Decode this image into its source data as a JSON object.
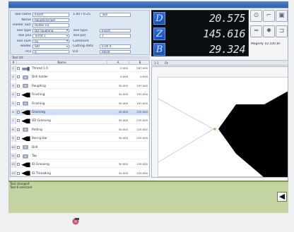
{
  "app": {
    "title": ""
  },
  "form": {
    "rows": [
      {
        "label": "Tool name",
        "v1": "Insert",
        "v1_type": "input",
        "v2": "1.00 / 0.25",
        "v3": "Tool"
      },
      {
        "label": "Name",
        "v1": "Roughing tool",
        "v1_type": "input",
        "v2": "",
        "v3": ""
      },
      {
        "label": "Holder name",
        "v1": "Holder 03",
        "v1_type": "input",
        "v2": "",
        "v3": ""
      },
      {
        "label": "Tool type",
        "v1": "OD roughing",
        "v1_type": "select",
        "v2": "Tool type",
        "v3": "Insert"
      },
      {
        "label": "Tool pos",
        "v1": "Turret 1",
        "v1_type": "select",
        "v2": "Tool pos",
        "v3": "1"
      },
      {
        "label": "Tool num",
        "v1": "01",
        "v1_type": "select",
        "v2": "Comment",
        "v3": ""
      },
      {
        "label": "Holder",
        "v1": "Std",
        "v1_type": "select",
        "v2": "Cutting data",
        "v3": "0.00 0"
      },
      {
        "label": "Pcs",
        "v1": "0",
        "v1_type": "input",
        "v2": "0.0",
        "v3": "Reset"
      }
    ]
  },
  "dro": {
    "axes": [
      {
        "axis": "D",
        "value": "20.575"
      },
      {
        "axis": "Z",
        "value": "145.616"
      },
      {
        "axis": "B",
        "value": "29.324"
      }
    ]
  },
  "right_buttons": {
    "status": "Magnify  10  100 ΔT"
  },
  "tree": {
    "header": "Tool list",
    "columns": [
      "#",
      "Name",
      "A",
      "B"
    ],
    "rows": [
      {
        "num": "1",
        "name": "Thread 1.0",
        "v1": "0.000",
        "v2": "267.000",
        "icon": "tool"
      },
      {
        "num": "2",
        "name": "Drill holder",
        "v1": "0.000",
        "v2": "0.000",
        "icon": "holder"
      },
      {
        "num": "3",
        "name": "Roughing",
        "v1": "30.000",
        "v2": "197.000",
        "icon": "holder"
      },
      {
        "num": "4",
        "name": "Finishing",
        "v1": "30.000",
        "v2": "197.000",
        "icon": "black"
      },
      {
        "num": "5",
        "name": "Finishing",
        "v1": "30.000",
        "v2": "197.000",
        "icon": "holder"
      },
      {
        "num": "6",
        "name": "Grooving",
        "v1": "30.000",
        "v2": "225.000",
        "icon": "black",
        "selected": true
      },
      {
        "num": "7",
        "name": "OD Grooving",
        "v1": "30.000",
        "v2": "225.000",
        "icon": "black"
      },
      {
        "num": "8",
        "name": "Parting",
        "v1": "30.000",
        "v2": "225.000",
        "icon": "holder"
      },
      {
        "num": "9",
        "name": "Boring bar",
        "v1": "30.000",
        "v2": "225.000",
        "icon": "black"
      },
      {
        "num": "10",
        "name": "Drill",
        "v1": "",
        "v2": "",
        "icon": "holder"
      },
      {
        "num": "11",
        "name": "Tap",
        "v1": "",
        "v2": "",
        "icon": "holder"
      },
      {
        "num": "12",
        "name": "ID Grooving",
        "v1": "30.000",
        "v2": "225.000",
        "icon": "black"
      },
      {
        "num": "13",
        "name": "ID Threading",
        "v1": "30.000",
        "v2": "225.000",
        "icon": "black"
      }
    ]
  },
  "viewport": {
    "toolbar": [
      "1:1",
      "Fit"
    ]
  },
  "info_panel": {
    "line1": "Tool changed",
    "line2": "Tool 6 selected"
  },
  "colors": {
    "dro_bg": "#0b0f12",
    "axis_button": "#2e6fd8",
    "info_panel": "#c4d4a0",
    "selection": "#cfe0f5"
  },
  "icons": {
    "right_buttons": [
      "target-icon",
      "fixture-icon",
      "camera-icon",
      "measure-icon",
      "gear-icon",
      "probe-icon"
    ],
    "status": "cnc-tool-icon",
    "expand": "expand-icon"
  }
}
